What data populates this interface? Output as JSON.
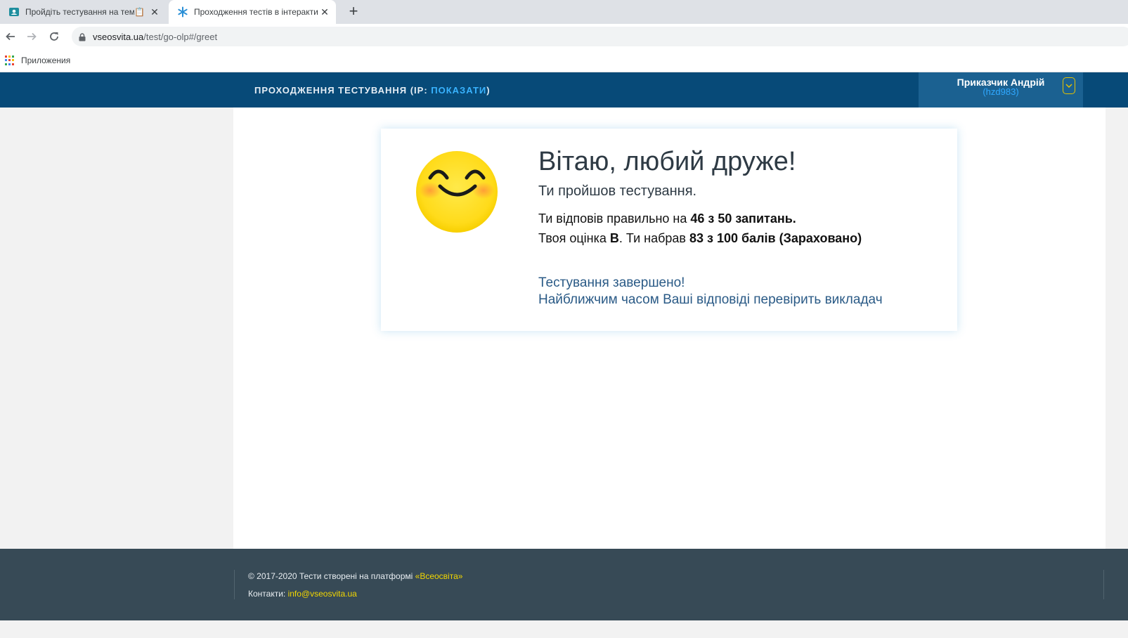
{
  "browser": {
    "tabs": [
      {
        "title": "Пройдіть тестування на тему:",
        "active": false
      },
      {
        "title": "Проходження тестів в інтеракти",
        "active": true
      }
    ],
    "new_tab_symbol": "+",
    "close_symbol": "✕",
    "url_host": "vseosvita.ua",
    "url_path": "/test/go-olp#/greet",
    "bookmarks_label": "Приложения"
  },
  "header": {
    "title_prefix": "ПРОХОДЖЕННЯ ТЕСТУВАННЯ (IP: ",
    "title_link": "ПОКАЗАТИ",
    "title_suffix": ")",
    "user_name": "Приказчик Андрій",
    "user_login": "(hzd983)"
  },
  "result": {
    "title": "Вітаю, любий друже!",
    "subtitle": "Ти пройшов тестування.",
    "line1_text": "Ти відповів правильно на ",
    "line1_bold": "46 з 50 запитань.",
    "line2_text_a": "Твоя оцінка ",
    "line2_grade": "В",
    "line2_text_b": ". Ти набрав ",
    "line2_bold": "83 з 100 балів (Зараховано)",
    "done_line1": "Тестування завершено!",
    "done_line2": "Найближчим часом Ваші відповіді перевірить викладач"
  },
  "footer": {
    "copyright_text": "© 2017-2020 Тести створені на платформі ",
    "copyright_link": "«Всеосвіта»",
    "contacts_label": "Контакти: ",
    "contacts_email": "info@vseosvita.ua"
  },
  "colors": {
    "header_bg": "#074a78",
    "user_box_bg": "#1b6191",
    "footer_bg": "#374a56",
    "link_yellow": "#f2d600",
    "link_blue": "#39b3ff"
  }
}
